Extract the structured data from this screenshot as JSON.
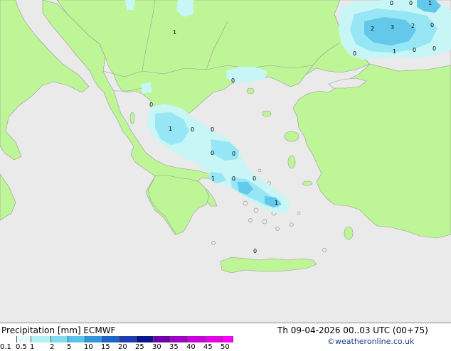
{
  "footer": {
    "title": "Precipitation [mm]  ECMWF",
    "datetime": "Th 09-04-2026 00..03 UTC (00+75)",
    "copyright": "©weatheronline.co.uk"
  },
  "legend": {
    "ticks": [
      "0.1",
      "0.5",
      "1",
      "2",
      "5",
      "10",
      "15",
      "20",
      "25",
      "30",
      "35",
      "40",
      "45",
      "50"
    ],
    "colors": [
      "#ffffff",
      "#e6fafa",
      "#b4f0f5",
      "#82dcf0",
      "#5ac3eb",
      "#3296dc",
      "#1e64c8",
      "#1e3cb4",
      "#0a148c",
      "#6e00aa",
      "#a000c8",
      "#c800dc",
      "#e600e6",
      "#ff00ff"
    ]
  },
  "colors": {
    "sea": "#eaeaea",
    "land": "#bef596",
    "precip_light": "#c8f5f5",
    "precip_medium": "#96e6f5",
    "precip_heavy": "#64c8eb"
  },
  "map_labels": [
    "0",
    "0",
    "1",
    "1",
    "0",
    "2",
    "3",
    "2",
    "0",
    "0",
    "1",
    "0",
    "0",
    "0",
    "0",
    "0",
    "1",
    "0",
    "0",
    "0",
    "1",
    "0",
    "1",
    "0",
    "0",
    "1",
    "0",
    "0"
  ]
}
